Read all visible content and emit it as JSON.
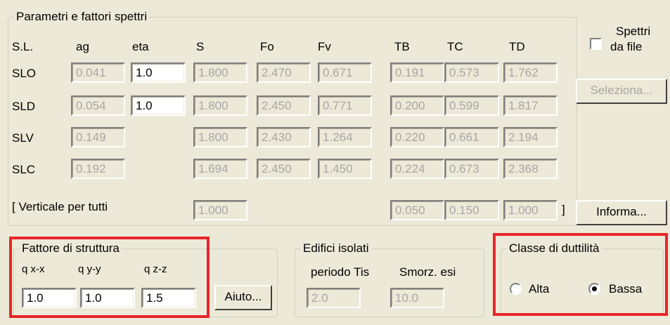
{
  "spectra": {
    "title": "Parametri e fattori spettri",
    "headers": {
      "sl": "S.L.",
      "ag": "ag",
      "eta": "eta",
      "s": "S",
      "fo": "Fo",
      "fv": "Fv",
      "tb": "TB",
      "tc": "TC",
      "td": "TD"
    },
    "rows": [
      {
        "label": "SLO",
        "ag": "0.041",
        "eta": "1.0",
        "s": "1.800",
        "fo": "2.470",
        "fv": "0.671",
        "tb": "0.191",
        "tc": "0.573",
        "td": "1.762"
      },
      {
        "label": "SLD",
        "ag": "0.054",
        "eta": "1.0",
        "s": "1.800",
        "fo": "2.450",
        "fv": "0.771",
        "tb": "0.200",
        "tc": "0.599",
        "td": "1.817"
      },
      {
        "label": "SLV",
        "ag": "0.149",
        "s": "1.800",
        "fo": "2.430",
        "fv": "1.264",
        "tb": "0.220",
        "tc": "0.661",
        "td": "2.194"
      },
      {
        "label": "SLC",
        "ag": "0.192",
        "s": "1.694",
        "fo": "2.450",
        "fv": "1.450",
        "tb": "0.224",
        "tc": "0.673",
        "td": "2.368"
      }
    ],
    "vertical": {
      "label": "[ Verticale per tutti",
      "s": "1.000",
      "tb": "0.050",
      "tc": "0.150",
      "td": "1.000",
      "close": "]"
    }
  },
  "side": {
    "checkbox_label_1": "Spettri",
    "checkbox_label_2": "da file",
    "checkbox_checked": false,
    "select_button": "Seleziona...",
    "info_button": "Informa..."
  },
  "structure": {
    "title": "Fattore di struttura",
    "labels": {
      "qx": "q x-x",
      "qy": "q y-y",
      "qz": "q z-z"
    },
    "values": {
      "qx": "1.0",
      "qy": "1.0",
      "qz": "1.5"
    },
    "help_button": "Aiuto..."
  },
  "isolated": {
    "title": "Edifici isolati",
    "labels": {
      "period": "periodo Tis",
      "damping": "Smorz. esi"
    },
    "values": {
      "period": "2.0",
      "damping": "10.0"
    }
  },
  "ductility": {
    "title": "Classe di duttilità",
    "options": [
      "Alta",
      "Bassa"
    ],
    "selected": "Bassa"
  },
  "colors": {
    "highlight": "#e8262a",
    "background": "#ece9d8"
  }
}
